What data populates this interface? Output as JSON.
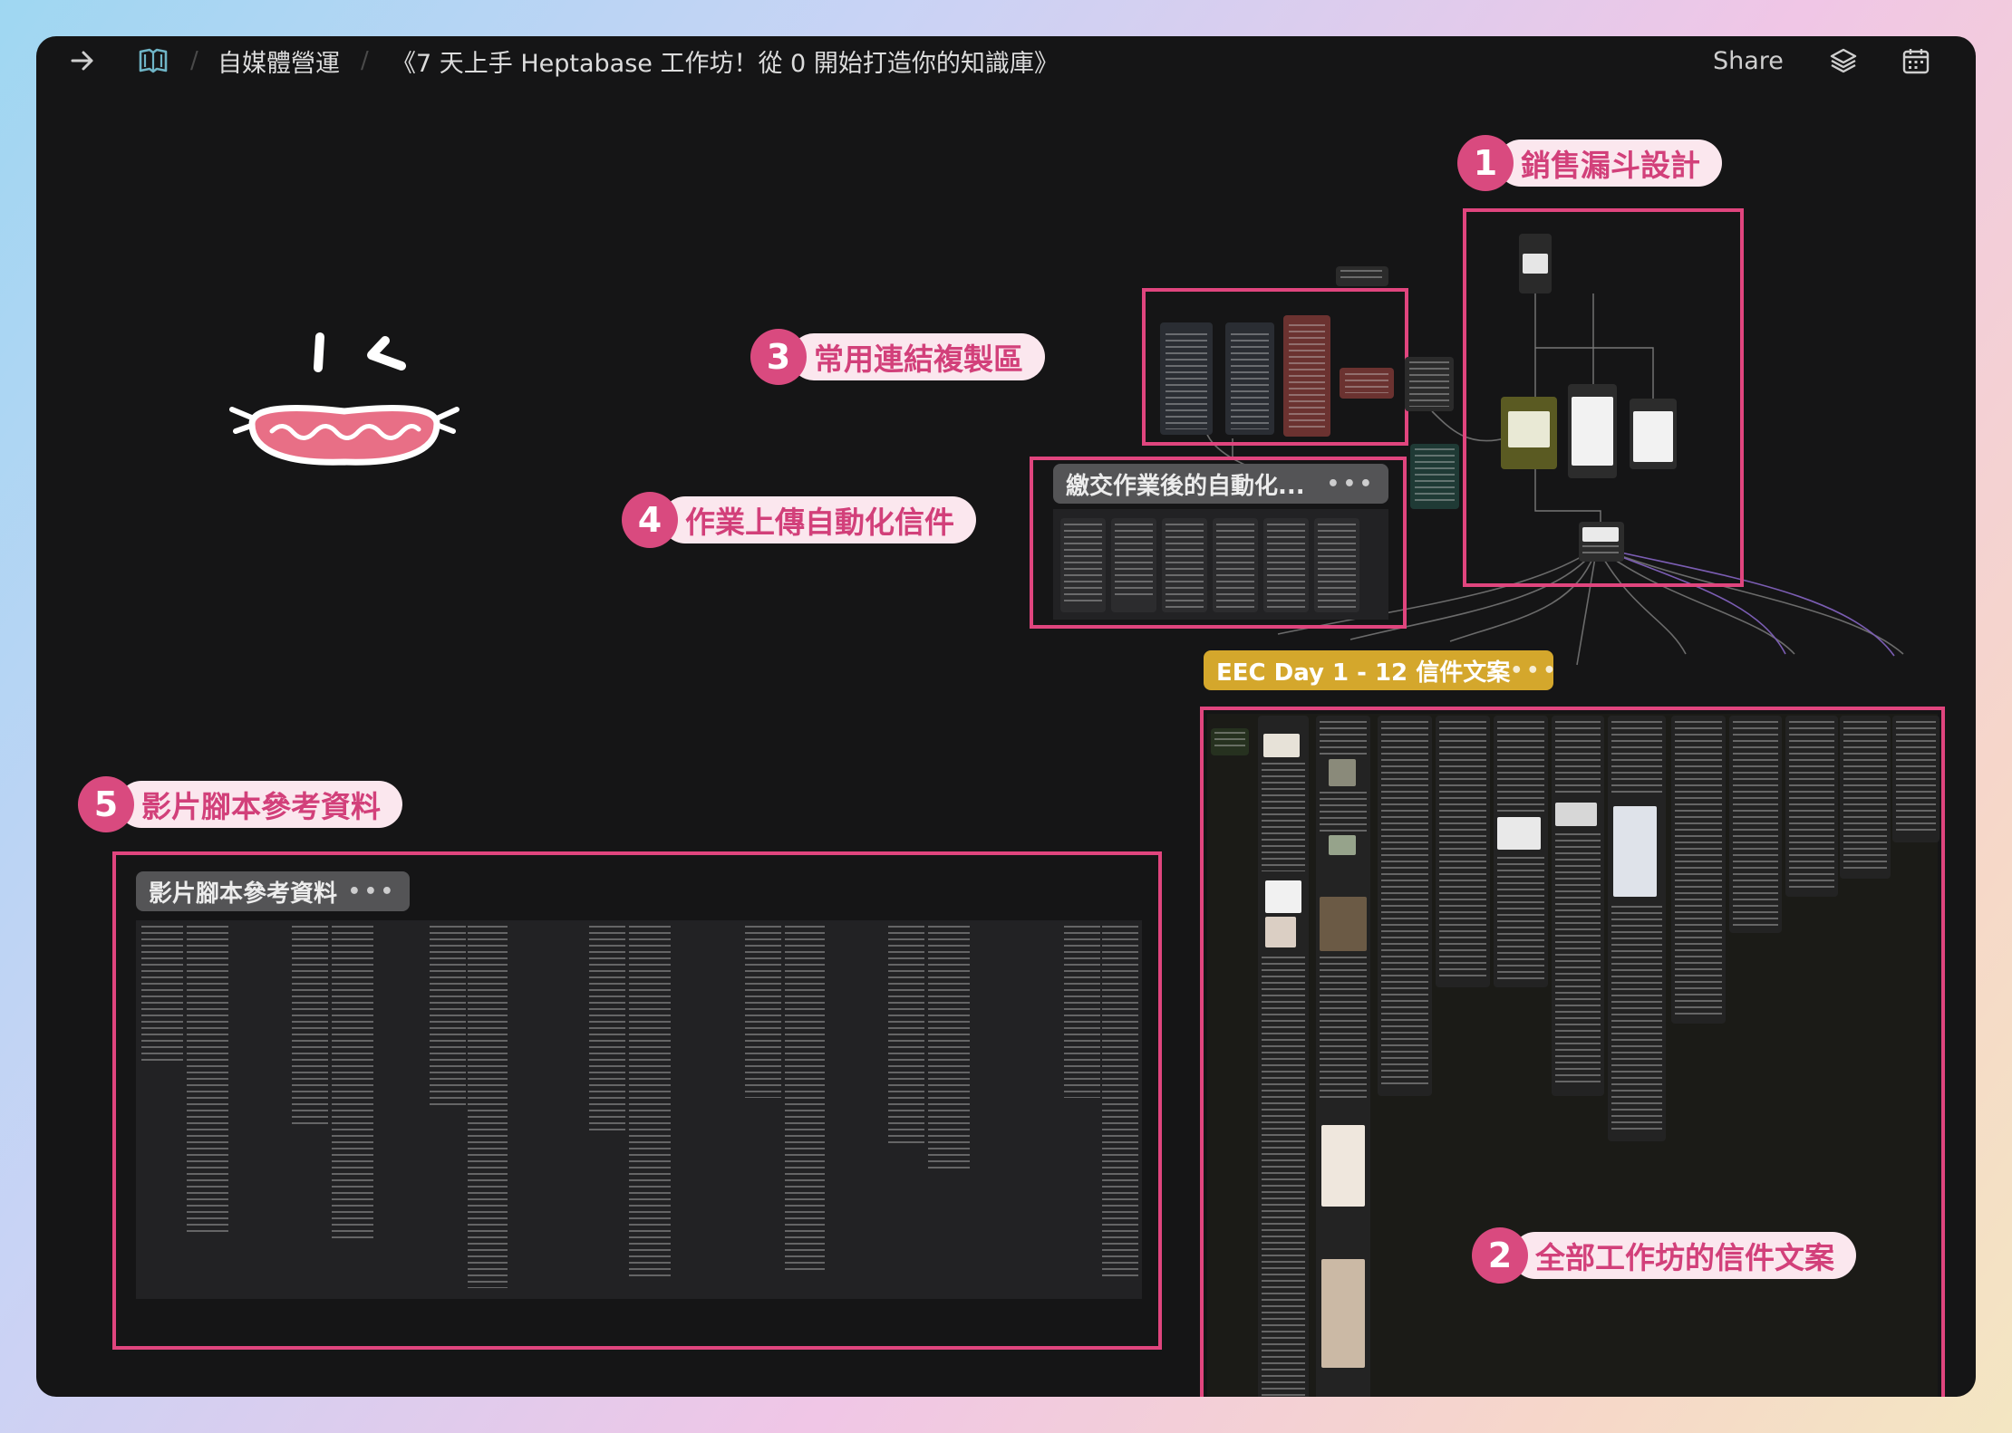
{
  "topbar": {
    "crumbs": [
      "自媒體營運",
      "《7 天上手 Heptabase 工作坊！從 0 開始打造你的知識庫》"
    ],
    "share_label": "Share",
    "icons": [
      "arrow-right-icon",
      "book-open-icon",
      "layers-icon",
      "calendar-icon"
    ]
  },
  "annotations": [
    {
      "number": "1",
      "label": "銷售漏斗設計"
    },
    {
      "number": "2",
      "label": "全部工作坊的信件文案"
    },
    {
      "number": "3",
      "label": "常用連結複製區"
    },
    {
      "number": "4",
      "label": "作業上傳自動化信件"
    },
    {
      "number": "5",
      "label": "影片腳本參考資料"
    }
  ],
  "sections": {
    "automation_title": "繳交作業後的自動化...",
    "eec_title": "EEC Day 1 - 12 信件文案",
    "video_title": "影片腳本參考資料",
    "more_dots": "•••"
  },
  "colors": {
    "annotation_accent": "#e0457e",
    "eec_label": "#d4a72c",
    "window_bg": "#151516"
  }
}
